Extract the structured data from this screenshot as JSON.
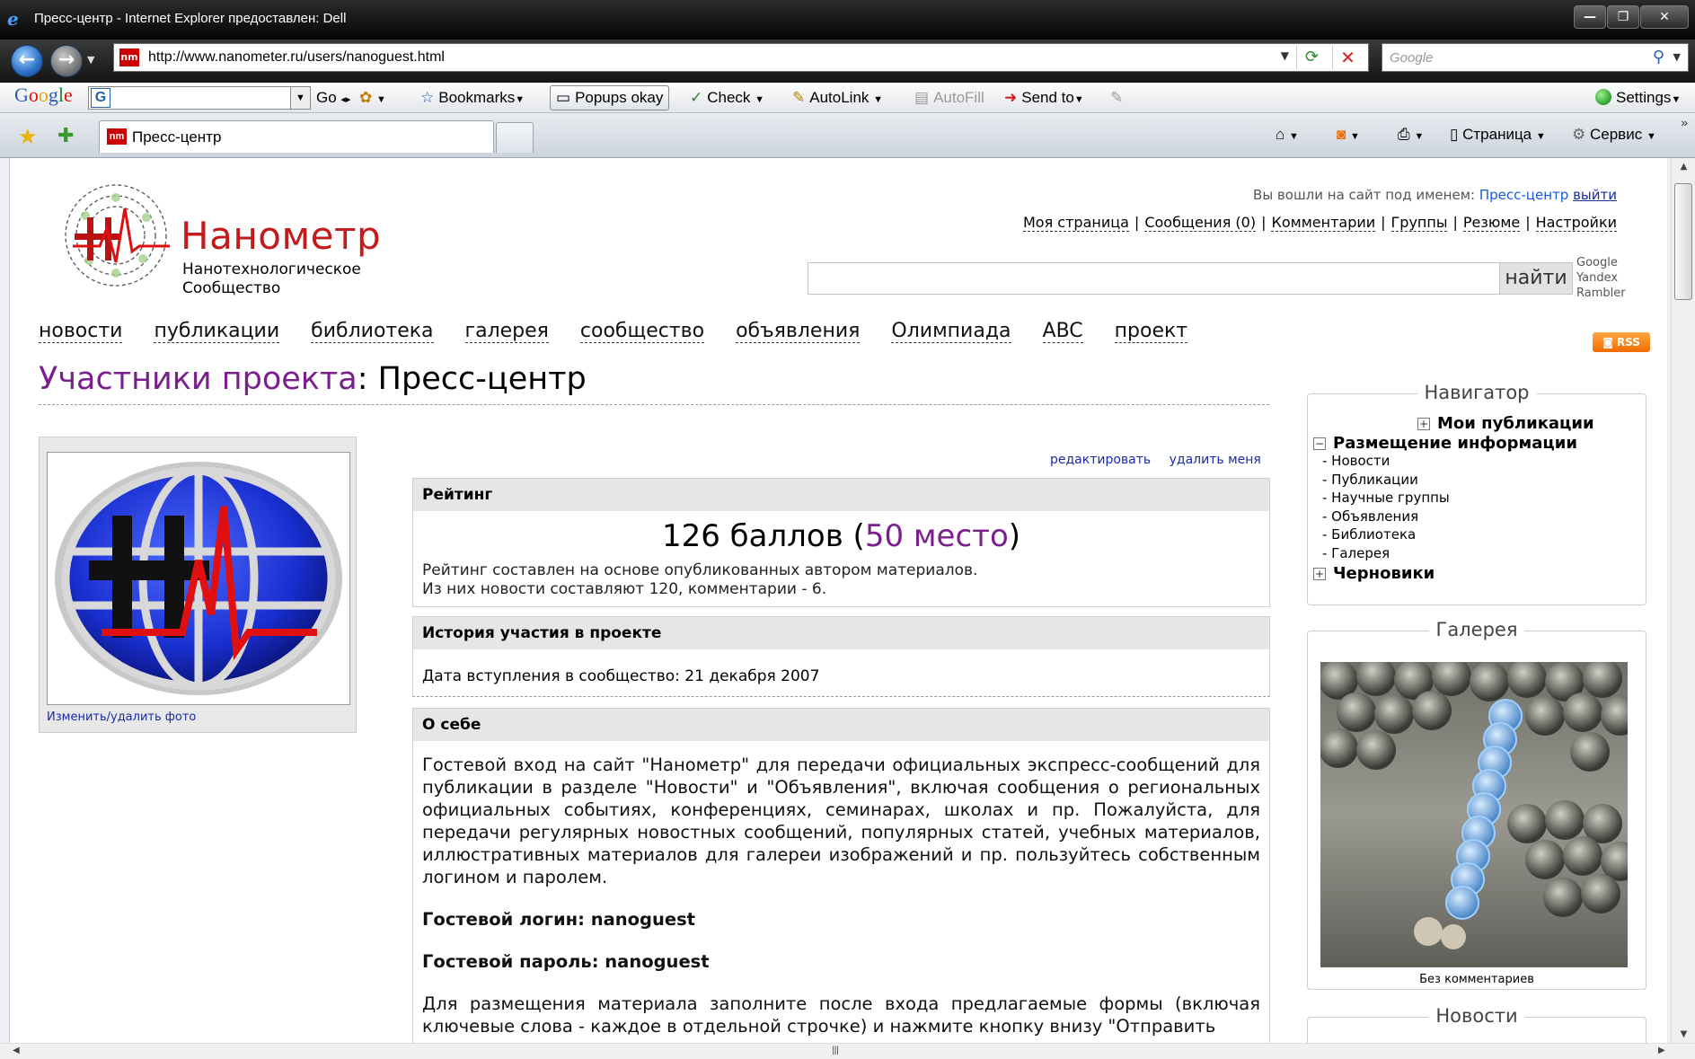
{
  "window": {
    "title": "Пресс-центр - Internet Explorer предоставлен: Dell",
    "min_label": "—",
    "max_label": "❐",
    "close_label": "✕"
  },
  "addressbar": {
    "url": "http://www.nanometer.ru/users/nanoguest.html",
    "search_placeholder": "Google"
  },
  "google_toolbar": {
    "logo": [
      "G",
      "o",
      "o",
      "g",
      "l",
      "e"
    ],
    "go_label": "Go",
    "bookmarks_label": "Bookmarks",
    "popups_label": "Popups okay",
    "check_label": "Check",
    "autolink_label": "AutoLink",
    "autofill_label": "AutoFill",
    "sendto_label": "Send to",
    "settings_label": "Settings"
  },
  "tabs": {
    "active_title": "Пресс-центр",
    "page_menu": "Страница",
    "tools_menu": "Сервис"
  },
  "site": {
    "name": "Нанометр",
    "subtitle_line1": "Нанотехнологическое",
    "subtitle_line2": "Сообщество",
    "login_prefix": "Вы вошли на сайт под именем:",
    "login_user": "Пресс-центр",
    "logout": "выйти",
    "user_menu": [
      "Моя страница",
      "Сообщения (0)",
      "Комментарии",
      "Группы",
      "Резюме",
      "Настройки"
    ],
    "search_button": "найти",
    "engines": [
      "Google",
      "Yandex",
      "Rambler"
    ],
    "main_nav": [
      "новости",
      "публикации",
      "библиотека",
      "галерея",
      "сообщество",
      "объявления",
      "Олимпиада",
      "ABC",
      "проект"
    ],
    "rss_label": "RSS"
  },
  "profile": {
    "breadcrumb_link": "Участники проекта",
    "name": ": Пресс-центр",
    "photo_link": "Изменить/удалить фото",
    "edit_link": "редактировать",
    "delete_link": "удалить меня",
    "rating": {
      "heading": "Рейтинг",
      "points": "126 баллов (",
      "place": "50 место",
      "close": ")",
      "line1": "Рейтинг составлен на основе опубликованных автором материалов.",
      "line2_a": "Из них ",
      "line2_link": "новости",
      "line2_b": " составляют 120, комментарии - 6."
    },
    "history": {
      "heading": "История участия в проекте",
      "joined": "Дата вступления в сообщество: 21 декабря 2007"
    },
    "about": {
      "heading": "О себе",
      "p1": "Гостевой вход на сайт \"Нанометр\" для передачи официальных экспресс-сообщений для публикации в разделе \"Новости\" и \"Объявления\", включая сообщения о региональных официальных событиях, конференциях, семинарах, школах и пр. Пожалуйста, для передачи регулярных новостных сообщений, популярных статей, учебных материалов, иллюстративных материалов для галереи изображений и пр. пользуйтесь собственным логином и паролем.",
      "login": "Гостевой логин: nanoguest",
      "password": "Гостевой пароль: nanoguest",
      "p2": "Для размещения материала заполните после входа предлагаемые формы (включая ключевые слова - каждое в отдельной строчке) и нажмите кнопку внизу \"Отправить"
    }
  },
  "sidebar": {
    "navigator_title": "Навигатор",
    "my_publications": "Мои публикации",
    "placement_section": "Размещение информации",
    "placement_items": [
      "- Новости",
      "- Публикации",
      "- Научные группы",
      "- Объявления",
      "- Библиотека",
      "- Галерея"
    ],
    "drafts": "Черновики",
    "gallery_title": "Галерея",
    "gallery_caption": "Без комментариев",
    "news_title": "Новости"
  },
  "colors": {
    "brand_red": "#c21b1b",
    "link_blue": "#1a2aa8",
    "visited_purple": "#7a1f8c"
  }
}
